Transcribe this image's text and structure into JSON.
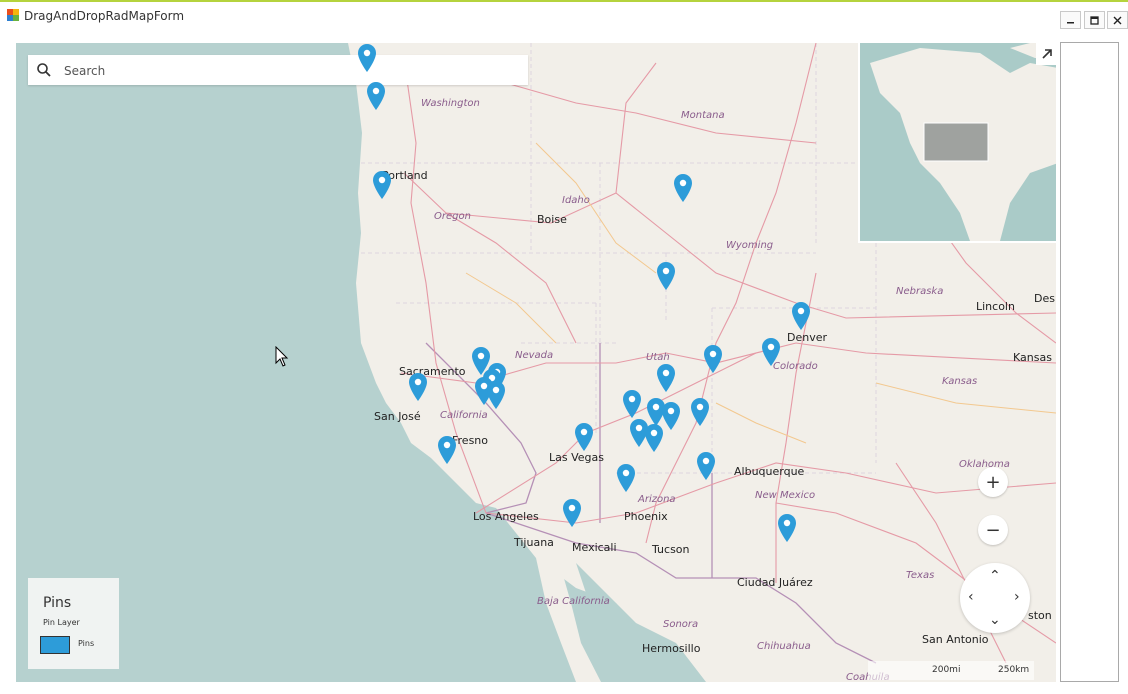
{
  "window": {
    "title": "DragAndDropRadMapForm",
    "icon": "app-form-icon",
    "controls": [
      "minimize-icon",
      "maximize-icon",
      "close-icon"
    ]
  },
  "search": {
    "placeholder": "Search",
    "value": "",
    "icon": "search-icon"
  },
  "minimap": {
    "expand_icon": "expand-arrow-icon"
  },
  "cities": [
    {
      "name": "Portland"
    },
    {
      "name": "Boise"
    },
    {
      "name": "Denver"
    },
    {
      "name": "Lincoln"
    },
    {
      "name": "Des"
    },
    {
      "name": "Kansas C"
    },
    {
      "name": "Sacramento"
    },
    {
      "name": "San José"
    },
    {
      "name": "Fresno"
    },
    {
      "name": "Las Vegas"
    },
    {
      "name": "Albuquerque"
    },
    {
      "name": "Los Angeles"
    },
    {
      "name": "Phoenix"
    },
    {
      "name": "Tijuana"
    },
    {
      "name": "Mexicali"
    },
    {
      "name": "Tucson"
    },
    {
      "name": "Ciudad Juárez"
    },
    {
      "name": "San Antonio"
    },
    {
      "name": "Hermosillo"
    },
    {
      "name": "ston"
    }
  ],
  "regions": [
    {
      "name": "Washington"
    },
    {
      "name": "Montana"
    },
    {
      "name": "Idaho"
    },
    {
      "name": "Oregon"
    },
    {
      "name": "Wyoming"
    },
    {
      "name": "Nebraska"
    },
    {
      "name": "Nevada"
    },
    {
      "name": "Utah"
    },
    {
      "name": "Colorado"
    },
    {
      "name": "Kansas"
    },
    {
      "name": "California"
    },
    {
      "name": "Arizona"
    },
    {
      "name": "New Mexico"
    },
    {
      "name": "Oklahoma"
    },
    {
      "name": "Texas"
    },
    {
      "name": "Baja California"
    },
    {
      "name": "Sonora"
    },
    {
      "name": "Chihuahua"
    },
    {
      "name": "Coahuila"
    }
  ],
  "pins_count": 27,
  "pin_color": "#2d9cd9",
  "zoom": {
    "in_label": "+",
    "out_label": "−"
  },
  "legend": {
    "title": "Pins",
    "subtitle": "Pin Layer",
    "items": [
      {
        "label": "Pins",
        "color": "#2d9cd9"
      }
    ]
  },
  "scale": {
    "imperial": "200mi",
    "metric": "250km"
  },
  "colors": {
    "water": "#b6d1cf",
    "land": "#f2efe9",
    "roads": "#e59aa6",
    "borders": "#b590b6",
    "accent_bar": "#b5d33d"
  }
}
